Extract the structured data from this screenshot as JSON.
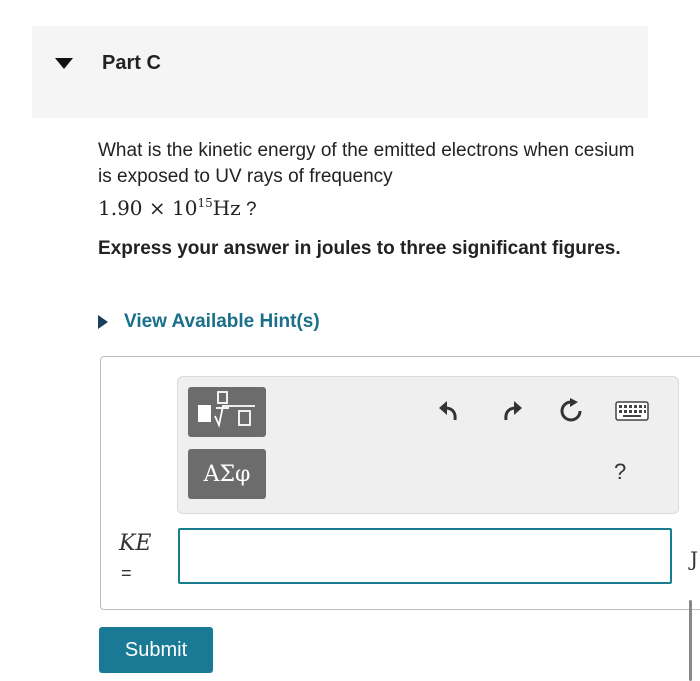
{
  "part": {
    "title": "Part C"
  },
  "question": {
    "text": "What is the kinetic energy of the emitted electrons when cesium is exposed to UV rays of frequency",
    "math_mantissa": "1.90 × 10",
    "math_exponent": "15",
    "math_unit": "Hz",
    "math_suffix": " ?"
  },
  "instruction": "Express your answer in joules to three significant figures.",
  "hints": {
    "label": "View Available Hint(s)"
  },
  "toolbar": {
    "template_icon": "fraction-root-template-icon",
    "greek_label": "ΑΣφ",
    "undo_icon": "undo-icon",
    "redo_icon": "redo-icon",
    "reset_icon": "reset-icon",
    "keyboard_icon": "keyboard-icon",
    "help_label": "?"
  },
  "answer": {
    "variable": "KE",
    "equals": "=",
    "value": "",
    "unit": "J"
  },
  "submit_label": "Submit",
  "colors": {
    "accent": "#1a7a96",
    "link": "#1a6f8a",
    "tool_button": "#6c6c6c",
    "header_bg": "#f5f5f5"
  }
}
